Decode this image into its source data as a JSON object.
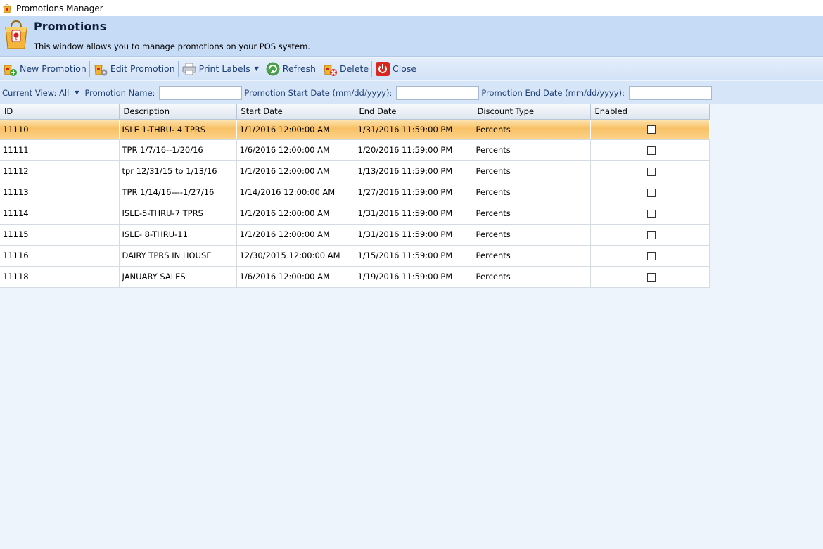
{
  "window": {
    "title": "Promotions Manager"
  },
  "header": {
    "title": "Promotions",
    "subtitle": "This window allows you to manage promotions on your POS system."
  },
  "toolbar": {
    "new_promotion": "New Promotion",
    "edit_promotion": "Edit Promotion",
    "print_labels": "Print Labels",
    "refresh": "Refresh",
    "delete": "Delete",
    "close": "Close"
  },
  "filters": {
    "current_view": "Current View: All",
    "promotion_name_label": "Promotion Name:",
    "promotion_name_value": "",
    "start_date_label": "Promotion Start Date (mm/dd/yyyy):",
    "start_date_value": "",
    "end_date_label": "Promotion End Date (mm/dd/yyyy):",
    "end_date_value": ""
  },
  "table": {
    "columns": [
      "ID",
      "Description",
      "Start Date",
      "End Date",
      "Discount Type",
      "Enabled"
    ],
    "selected_index": 0,
    "rows": [
      {
        "id": "11110",
        "description": "ISLE 1-THRU- 4 TPRS",
        "start": "1/1/2016 12:00:00 AM",
        "end": "1/31/2016 11:59:00 PM",
        "discount": "Percents",
        "enabled": false
      },
      {
        "id": "11111",
        "description": "TPR 1/7/16--1/20/16",
        "start": "1/6/2016 12:00:00 AM",
        "end": "1/20/2016 11:59:00 PM",
        "discount": "Percents",
        "enabled": false
      },
      {
        "id": "11112",
        "description": "tpr 12/31/15 to 1/13/16",
        "start": "1/1/2016 12:00:00 AM",
        "end": "1/13/2016 11:59:00 PM",
        "discount": "Percents",
        "enabled": false
      },
      {
        "id": "11113",
        "description": "TPR 1/14/16----1/27/16",
        "start": "1/14/2016 12:00:00 AM",
        "end": "1/27/2016 11:59:00 PM",
        "discount": "Percents",
        "enabled": false
      },
      {
        "id": "11114",
        "description": "ISLE-5-THRU-7 TPRS",
        "start": "1/1/2016 12:00:00 AM",
        "end": "1/31/2016 11:59:00 PM",
        "discount": "Percents",
        "enabled": false
      },
      {
        "id": "11115",
        "description": "ISLE- 8-THRU-11",
        "start": "1/1/2016 12:00:00 AM",
        "end": "1/31/2016 11:59:00 PM",
        "discount": "Percents",
        "enabled": false
      },
      {
        "id": "11116",
        "description": "DAIRY TPRS IN HOUSE",
        "start": "12/30/2015 12:00:00 AM",
        "end": "1/15/2016 11:59:00 PM",
        "discount": "Percents",
        "enabled": false
      },
      {
        "id": "11118",
        "description": "JANUARY SALES",
        "start": "1/6/2016 12:00:00 AM",
        "end": "1/19/2016 11:59:00 PM",
        "discount": "Percents",
        "enabled": false
      }
    ]
  },
  "icons": {
    "app": "shopping-bag-icon",
    "new": "tag-add-icon",
    "edit": "tag-edit-icon",
    "print": "printer-icon",
    "refresh": "refresh-icon",
    "delete": "tag-delete-icon",
    "close": "power-icon"
  },
  "colors": {
    "header_bg": "#c6dbf5",
    "toolbar_text": "#1d3f75",
    "selected_row": "#f8c166",
    "workspace_bg": "#eef4fc"
  }
}
